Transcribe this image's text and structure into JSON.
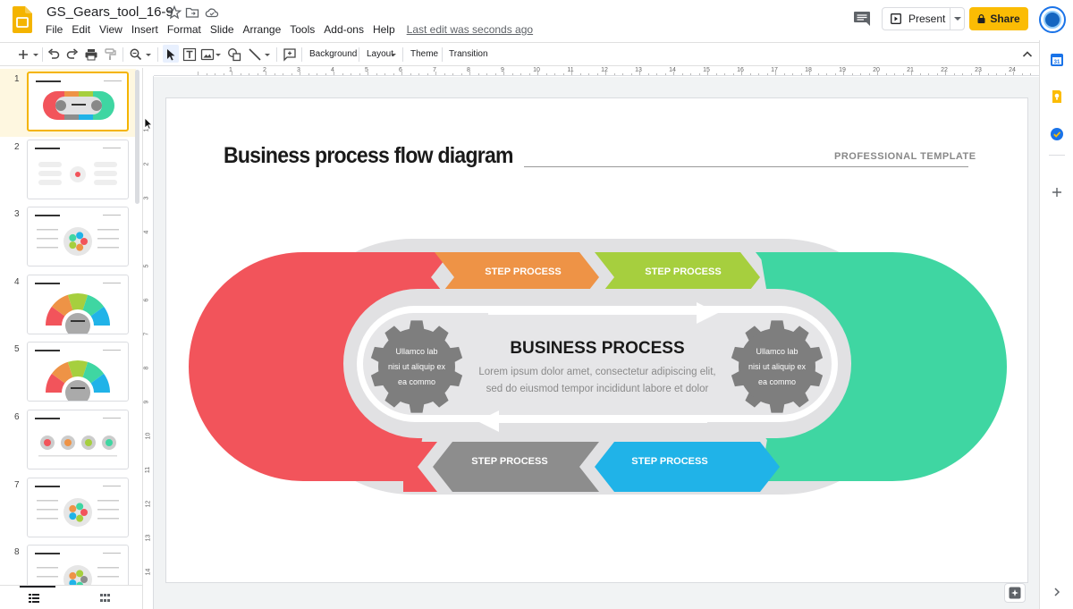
{
  "app": {
    "doc_title": "GS_Gears_tool_16-9"
  },
  "menu": [
    "File",
    "Edit",
    "View",
    "Insert",
    "Format",
    "Slide",
    "Arrange",
    "Tools",
    "Add-ons",
    "Help"
  ],
  "last_edit": "Last edit was seconds ago",
  "header": {
    "present_label": "Present",
    "share_label": "Share"
  },
  "toolbar": {
    "background": "Background",
    "layout": "Layout",
    "theme": "Theme",
    "transition": "Transition"
  },
  "ruler_top": [
    "1",
    "2",
    "3",
    "4",
    "5",
    "6",
    "7",
    "8",
    "9",
    "10",
    "11",
    "12",
    "13",
    "14",
    "15",
    "16",
    "17",
    "18",
    "19",
    "20",
    "21",
    "22",
    "23",
    "24",
    "25"
  ],
  "ruler_left": [
    "1",
    "2",
    "3",
    "4",
    "5",
    "6",
    "7",
    "8",
    "9",
    "10",
    "11",
    "12",
    "13",
    "14"
  ],
  "filmstrip": {
    "slides": [
      {
        "num": "1",
        "active": true
      },
      {
        "num": "2",
        "active": false
      },
      {
        "num": "3",
        "active": false
      },
      {
        "num": "4",
        "active": false
      },
      {
        "num": "5",
        "active": false
      },
      {
        "num": "6",
        "active": false
      },
      {
        "num": "7",
        "active": false
      },
      {
        "num": "8",
        "active": false
      }
    ]
  },
  "slide": {
    "title": "Business process flow diagram",
    "subtitle": "PROFESSIONAL TEMPLATE",
    "steps": [
      "STEP PROCESS",
      "STEP PROCESS",
      "STEP PROCESS",
      "STEP PROCESS"
    ],
    "center_title": "BUSINESS PROCESS",
    "center_line1": "Lorem ipsum dolor amet, consectetur adipiscing elit,",
    "center_line2": "sed do eiusmod tempor incididunt  labore et dolor",
    "gear_left": [
      "Ullamco lab",
      "nisi ut aliquip ex",
      "ea commo"
    ],
    "gear_right": [
      "Ullamco lab",
      "nisi ut aliquip ex",
      "ea commo"
    ]
  },
  "colors": {
    "red": "#f2545b",
    "green": "#3fd6a2",
    "orange": "#ee9346",
    "lime": "#a6cf3e",
    "gray": "#8d8d8d",
    "blue": "#20b3e8",
    "track": "#e1e1e3",
    "gear": "#7e7e7e",
    "share": "#fbbc04"
  }
}
